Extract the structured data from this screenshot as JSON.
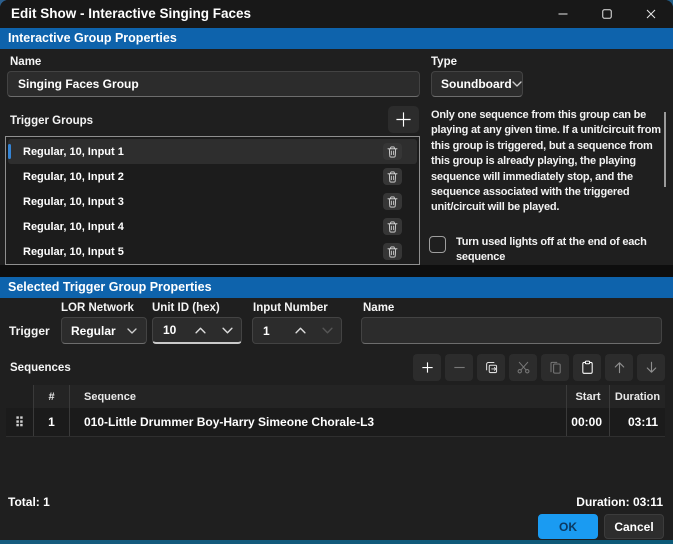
{
  "window": {
    "title": "Edit Show - Interactive Singing Faces"
  },
  "group_properties": {
    "header": "Interactive Group Properties",
    "name_label": "Name",
    "name_value": "Singing Faces Group",
    "type_label": "Type",
    "type_value": "Soundboard",
    "trigger_groups_label": "Trigger Groups",
    "trigger_groups": [
      {
        "label": "Regular, 10, Input 1",
        "selected": true
      },
      {
        "label": "Regular, 10, Input 2",
        "selected": false
      },
      {
        "label": "Regular, 10, Input 3",
        "selected": false
      },
      {
        "label": "Regular, 10, Input 4",
        "selected": false
      },
      {
        "label": "Regular, 10, Input 5",
        "selected": false
      }
    ],
    "info_text": "Only one sequence from this group can be playing at any given time. If a unit/circuit from this group is triggered, but a sequence from this group is already playing, the playing sequence will immediately stop, and the sequence associated with the triggered unit/circuit will be played.",
    "lights_off_checkbox_label": "Turn used lights off at the end of each sequence",
    "lights_off_checkbox_checked": false
  },
  "trigger_properties": {
    "header": "Selected Trigger Group Properties",
    "row_label": "Trigger",
    "lor_network_label": "LOR Network",
    "lor_network_value": "Regular",
    "unit_id_label": "Unit ID (hex)",
    "unit_id_value": "10",
    "input_number_label": "Input Number",
    "input_number_value": "1",
    "name_label": "Name",
    "name_value": ""
  },
  "sequences": {
    "label": "Sequences",
    "columns": {
      "number": "#",
      "sequence": "Sequence",
      "start": "Start",
      "duration": "Duration"
    },
    "rows": [
      {
        "number": "1",
        "sequence": "010-Little Drummer Boy-Harry Simeone Chorale-L3",
        "start": "00:00",
        "duration": "03:11"
      }
    ],
    "total_label": "Total: 1",
    "duration_label": "Duration: 03:11"
  },
  "footer": {
    "ok_label": "OK",
    "cancel_label": "Cancel"
  },
  "icons": {
    "drag_handle": "⠿"
  },
  "colors": {
    "section_header_bg": "#0e63ac",
    "selection_accent": "#3584d4",
    "ok_button_bg": "#1a9bf2",
    "panel_bg": "#1f1f1f"
  }
}
